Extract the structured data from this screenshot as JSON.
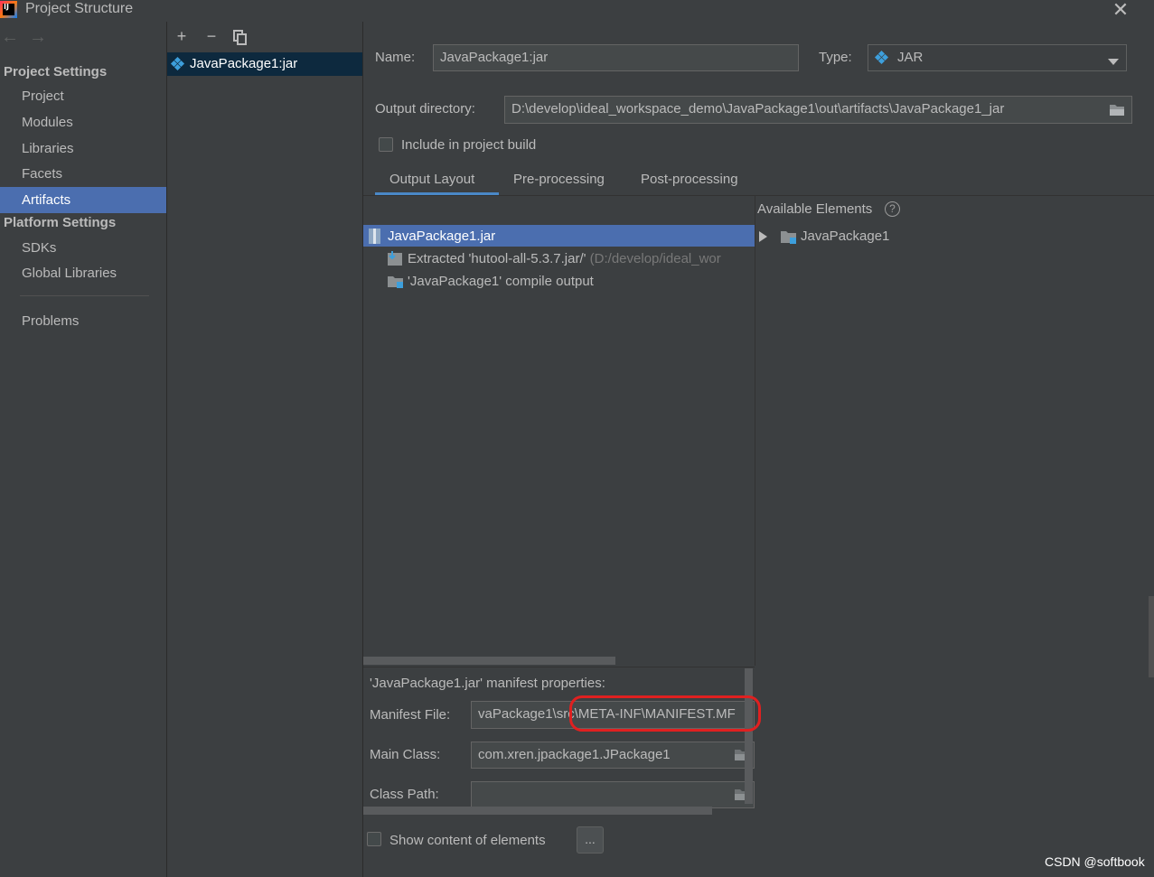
{
  "window": {
    "title": "Project Structure",
    "app_icon_text": "IJ"
  },
  "sidebar": {
    "project_settings_header": "Project Settings",
    "project_items": [
      "Project",
      "Modules",
      "Libraries",
      "Facets",
      "Artifacts"
    ],
    "selected": "Artifacts",
    "platform_settings_header": "Platform Settings",
    "platform_items": [
      "SDKs",
      "Global Libraries"
    ],
    "problems": "Problems"
  },
  "artifacts_list": {
    "items": [
      "JavaPackage1:jar"
    ]
  },
  "form": {
    "name_label": "Name:",
    "name_value": "JavaPackage1:jar",
    "type_label": "Type:",
    "type_value": "JAR",
    "output_dir_label": "Output directory:",
    "output_dir_value": "D:\\develop\\ideal_workspace_demo\\JavaPackage1\\out\\artifacts\\JavaPackage1_jar",
    "include_build_label": "Include in project build",
    "include_build_checked": false
  },
  "tabs": [
    "Output Layout",
    "Pre-processing",
    "Post-processing"
  ],
  "active_tab": "Output Layout",
  "output_layout": {
    "tree": {
      "root": "JavaPackage1.jar",
      "children": [
        {
          "label": "Extracted 'hutool-all-5.3.7.jar/'",
          "detail": "(D:/develop/ideal_wor"
        },
        {
          "label": "'JavaPackage1' compile output",
          "detail": ""
        }
      ]
    },
    "available_elements_label": "Available Elements",
    "available_elements": [
      "JavaPackage1"
    ]
  },
  "manifest": {
    "title": "'JavaPackage1.jar' manifest properties:",
    "manifest_file_label": "Manifest File:",
    "manifest_file_value": "vaPackage1\\src\\META-INF\\MANIFEST.MF",
    "main_class_label": "Main Class:",
    "main_class_value": "com.xren.jpackage1.JPackage1",
    "class_path_label": "Class Path:",
    "class_path_value": ""
  },
  "show_content_label": "Show content of elements",
  "more_button": "...",
  "watermark": "CSDN @softbook",
  "colors": {
    "background": "#3c3f41",
    "selection": "#4b6eaf",
    "annotation_ring": "#e02020"
  }
}
